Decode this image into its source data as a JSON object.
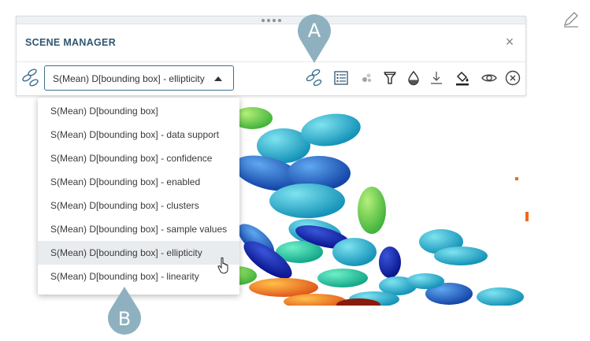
{
  "panel": {
    "title": "SCENE MANAGER",
    "close_glyph": "×",
    "selected_layer": "S(Mean) D[bounding box] - ellipticity"
  },
  "toolbar_icons": [
    "layer-icon",
    "legend-icon",
    "points-icon",
    "filter-icon",
    "opacity-icon",
    "download-icon",
    "paint-bucket-icon",
    "eye-icon",
    "close-circle-icon"
  ],
  "dropdown": {
    "options": [
      "S(Mean) D[bounding box]",
      "S(Mean) D[bounding box] - data support",
      "S(Mean) D[bounding box] - confidence",
      "S(Mean) D[bounding box] - enabled",
      "S(Mean) D[bounding box] - clusters",
      "S(Mean) D[bounding box] - sample values",
      "S(Mean) D[bounding box] - ellipticity",
      "S(Mean) D[bounding box] - linearity"
    ],
    "selected_index": 6
  },
  "callouts": {
    "a": "A",
    "b": "B"
  },
  "colors": {
    "accent": "#2f5670",
    "callout": "#8fb1bf",
    "icon": "#3a6f8f"
  }
}
